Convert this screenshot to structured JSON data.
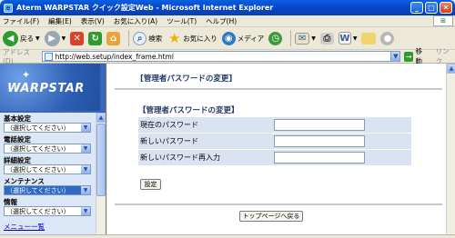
{
  "window": {
    "title": "Aterm WARPSTAR クイック設定Web - Microsoft Internet Explorer"
  },
  "menu": [
    "ファイル(F)",
    "編集(E)",
    "表示(V)",
    "お気に入り(A)",
    "ツール(T)",
    "ヘルプ(H)"
  ],
  "toolbar": {
    "back": "戻る",
    "search": "検索",
    "favorites": "お気に入り",
    "media": "メディア"
  },
  "address": {
    "label": "アドレス(D)",
    "url": "http://web.setup/index_frame.html",
    "go": "移動",
    "links": "リンク"
  },
  "sidebar": {
    "logo": "WARPSTAR",
    "groups": [
      {
        "label": "基本設定",
        "value": "（選択してください）"
      },
      {
        "label": "電話設定",
        "value": "（選択してください）"
      },
      {
        "label": "詳細設定",
        "value": "（選択してください）"
      },
      {
        "label": "メンテナンス",
        "value": "（選択してください）"
      },
      {
        "label": "情報",
        "value": "（選択してください）"
      }
    ],
    "menu_link": "メニュー一覧"
  },
  "main": {
    "page_title": "[管理者パスワードの変更]",
    "form_title": "【管理者パスワードの変更】",
    "fields": [
      {
        "label": "現在のパスワード",
        "value": ""
      },
      {
        "label": "新しいパスワード",
        "value": ""
      },
      {
        "label": "新しいパスワード再入力",
        "value": ""
      }
    ],
    "set_button": "設定",
    "top_button": "トップページへ戻る"
  },
  "colors": {
    "titlebar": "#0646c8",
    "sidebar": "#3a66b6",
    "form_row": "#dbe3f2",
    "active_select": "#316ac5"
  }
}
